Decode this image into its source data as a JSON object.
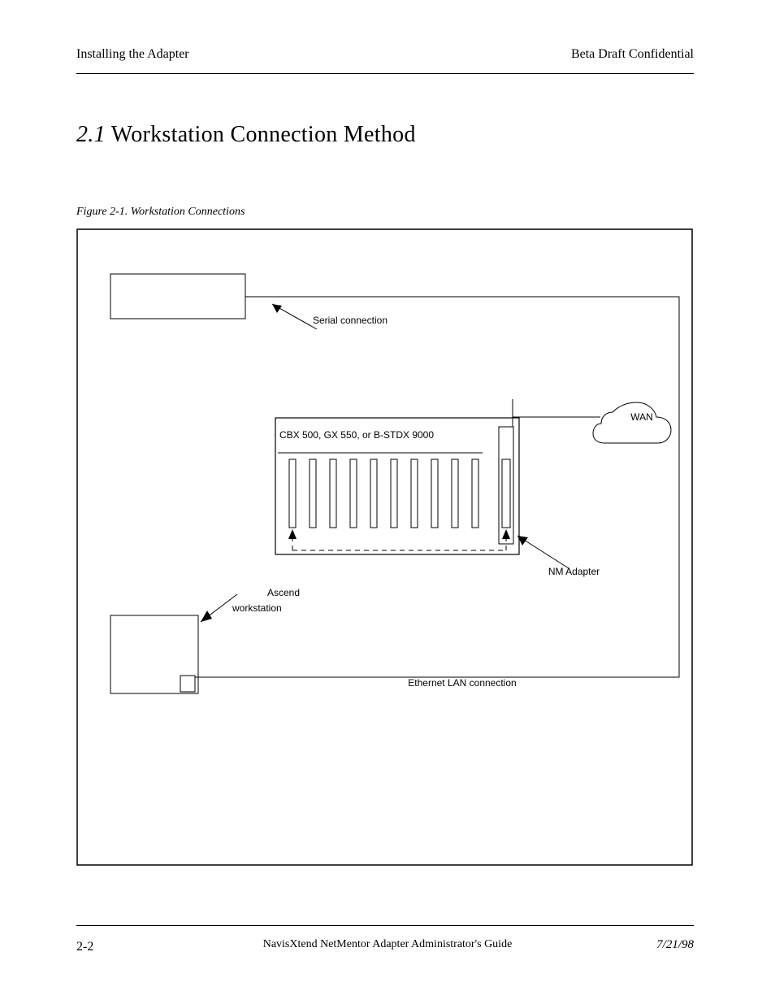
{
  "header": {
    "left": "Installing the Adapter",
    "right": "Beta Draft Confidential"
  },
  "chapter": {
    "number": "2.1",
    "spacer": "   ",
    "title": "Workstation Connection Method"
  },
  "figure": {
    "line1": "Figure 2-1.",
    "line2": "Workstation Connections"
  },
  "labels": {
    "serial": "Serial connection",
    "wan": "WAN",
    "cbx": "CBX 500, GX 550, or B-STDX 9000",
    "nmadapter_label": "NM Adapter",
    "workstation_title": "Ascend",
    "workstation_sub": "workstation",
    "lan": "Ethernet LAN connection"
  },
  "footer": {
    "left": "2-2",
    "center": "NavisXtend NetMentor Adapter Administrator's Guide",
    "right": "7/21/98"
  }
}
